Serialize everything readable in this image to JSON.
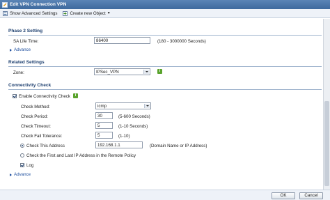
{
  "window": {
    "title": "Edit VPN Connection VPN"
  },
  "toolbar": {
    "show_advanced": "Show Advanced Settings",
    "create_object": "Create new Object"
  },
  "phase2": {
    "title": "Phase 2 Setting",
    "sa_life_label": "SA Life Time:",
    "sa_life_value": "86400",
    "sa_life_hint": "(180 - 3000000 Seconds)",
    "advance": "Advance"
  },
  "related": {
    "title": "Related Settings",
    "zone_label": "Zone:",
    "zone_value": "IPSec_VPN"
  },
  "connectivity": {
    "title": "Connectivity Check",
    "enable_label": "Enable Connectivity Check",
    "method_label": "Check Method:",
    "method_value": "icmp",
    "period_label": "Check Period:",
    "period_value": "30",
    "period_hint": "(5-600 Seconds)",
    "timeout_label": "Check Timeout:",
    "timeout_value": "5",
    "timeout_hint": "(1-10 Seconds)",
    "fail_label": "Check Fail Tolerance:",
    "fail_value": "5",
    "fail_hint": "(1-10)",
    "address_label": "Check This Address",
    "address_value": "192.168.1.1",
    "address_hint": "(Domain Name or IP Address)",
    "first_last_label": "Check the First and Last IP Address in the Remote Policy",
    "log_label": "Log",
    "advance": "Advance"
  },
  "footer": {
    "ok": "OK",
    "cancel": "Cancel"
  }
}
